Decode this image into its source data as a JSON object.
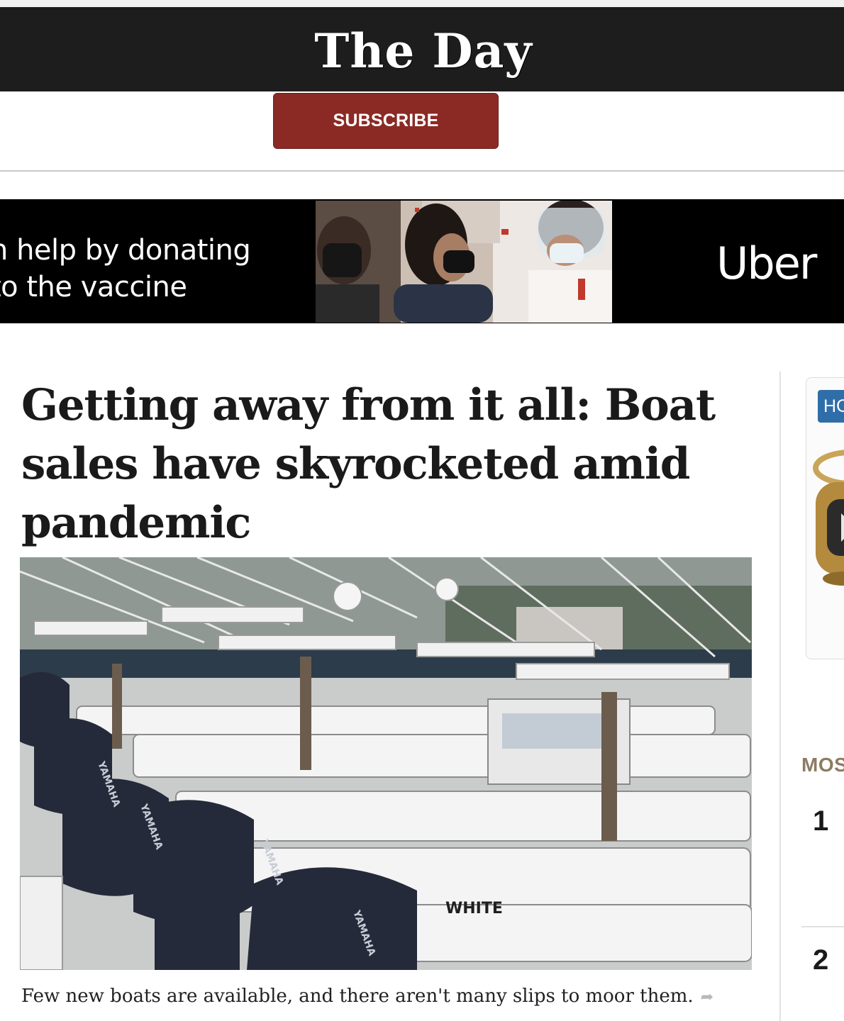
{
  "masthead": {
    "logo_text": "The Day"
  },
  "subscribe": {
    "label": "SUBSCRIBE"
  },
  "ad": {
    "line1": "n help by donating",
    "line2": "to the vaccine",
    "brand": "Uber"
  },
  "article": {
    "headline": "Getting away from it all: Boat sales have skyrocketed amid pandemic",
    "caption": "Few new boats are available, and there aren't many slips to moor them.",
    "photo_labels": {
      "engine1": "YAMAHA",
      "engine2": "YAMAHA",
      "engine3": "YAMAHA",
      "engine4": "YAMAHA",
      "hull": "WHITE"
    }
  },
  "rail": {
    "badge": "HC",
    "most_heading": "MOS",
    "number1": "1",
    "number2": "2"
  },
  "colors": {
    "masthead_bg": "#1d1d1d",
    "subscribe_bg": "#8b2a24",
    "badge_bg": "#2f6ea9",
    "most_heading": "#8d7b63"
  },
  "icons": {
    "share": "share-arrow-icon"
  }
}
